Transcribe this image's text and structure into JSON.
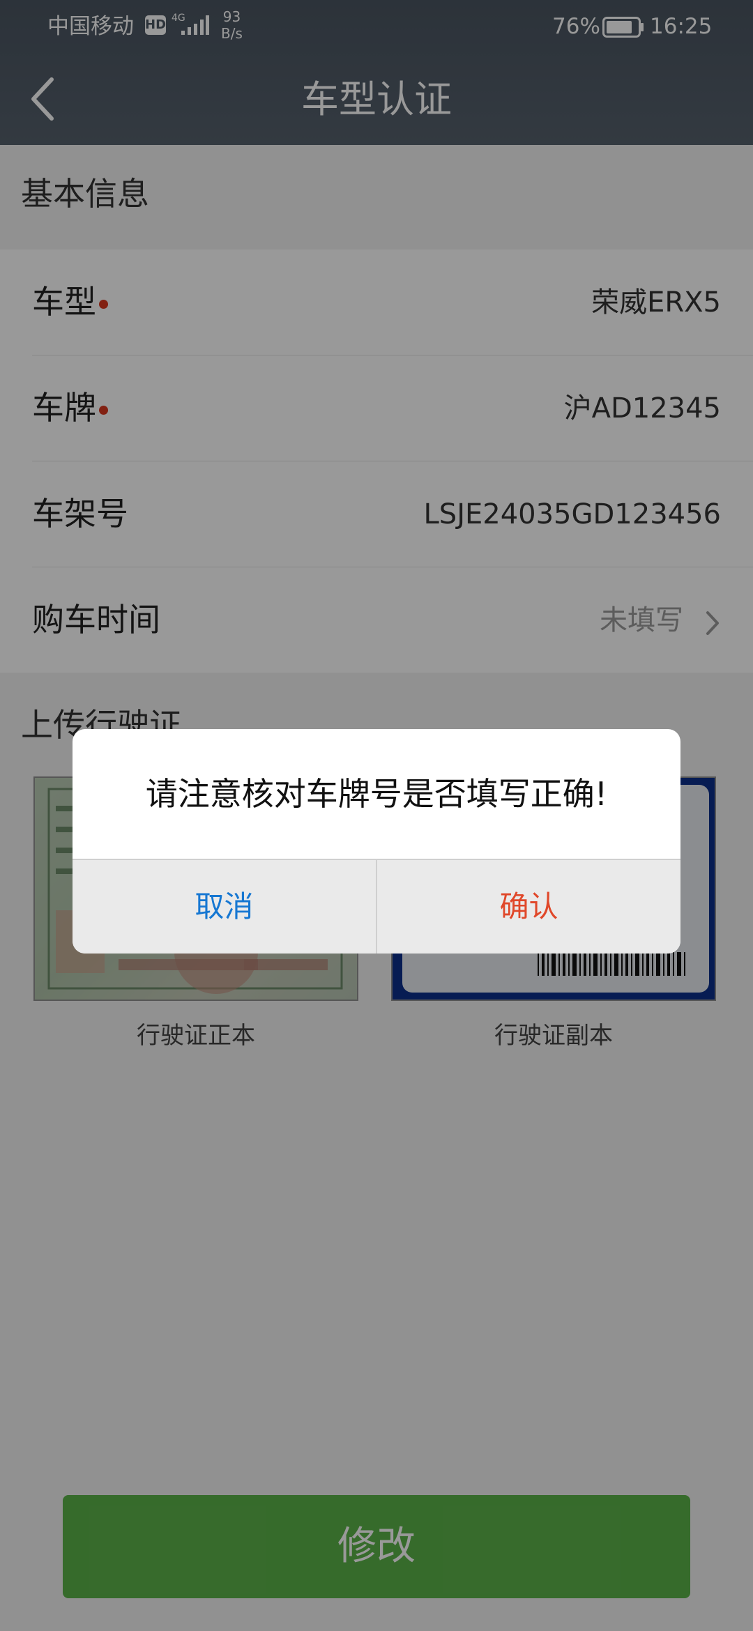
{
  "status_bar": {
    "carrier": "中国移动",
    "hd_badge": "HD",
    "network_type": "4G",
    "net_speed_value": "93",
    "net_speed_unit": "B/s",
    "battery": "76%",
    "time": "16:25"
  },
  "header": {
    "title": "车型认证"
  },
  "basic_info": {
    "section_title": "基本信息",
    "rows": [
      {
        "label": "车型",
        "value": "荣威ERX5",
        "required": true
      },
      {
        "label": "车牌",
        "value": "沪AD12345",
        "required": true
      },
      {
        "label": "车架号",
        "value": "LSJE24035GD123456",
        "required": false
      },
      {
        "label": "购车时间",
        "value": "未填写",
        "required": false
      }
    ]
  },
  "upload": {
    "section_title": "上传行驶证",
    "front_caption": "行驶证正本",
    "back_caption": "行驶证副本"
  },
  "bottom": {
    "edit_label": "修改"
  },
  "dialog": {
    "message": "请注意核对车牌号是否填写正确!",
    "cancel_label": "取消",
    "confirm_label": "确认"
  },
  "colors": {
    "header": "#4a5561",
    "required_dot": "#d9371f",
    "edit_button": "#5bb349",
    "cancel": "#1677d2",
    "confirm": "#e0482a"
  },
  "icons": {
    "back": "chevron-left-icon",
    "row_arrow": "chevron-right-icon",
    "signal": "signal-bars-icon",
    "battery": "battery-icon"
  }
}
